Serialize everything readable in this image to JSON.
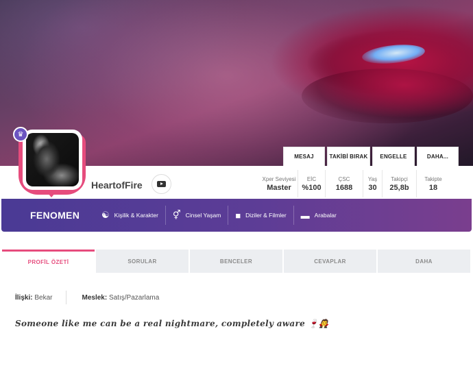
{
  "profile": {
    "username": "HeartofFire",
    "rank": "FENOMEN",
    "crown_icon": "crown-icon",
    "accent_color": "#e64c7d",
    "brand_purple": "#4a3a95"
  },
  "actions": {
    "message": "MESAJ",
    "unfollow": "TAKİBİ BIRAK",
    "block": "ENGELLE",
    "more": "DAHA..."
  },
  "stats": [
    {
      "label": "Xper Seviyesi",
      "value": "Master"
    },
    {
      "label": "EİC",
      "value": "%100"
    },
    {
      "label": "ÇSC",
      "value": "1688"
    },
    {
      "label": "Yaş",
      "value": "30"
    },
    {
      "label": "Takipçi",
      "value": "25,8b"
    },
    {
      "label": "Takipte",
      "value": "18"
    }
  ],
  "nav": {
    "items": [
      {
        "label": "Kişilik & Karakter",
        "icon": "personality-icon"
      },
      {
        "label": "Cinsel Yaşam",
        "icon": "gender-icon"
      },
      {
        "label": "Diziler & Filmler",
        "icon": "camera-icon"
      },
      {
        "label": "Arabalar",
        "icon": "car-icon"
      }
    ]
  },
  "tabs": [
    {
      "label": "PROFİL ÖZETİ"
    },
    {
      "label": "SORULAR"
    },
    {
      "label": "BENCELER"
    },
    {
      "label": "CEVAPLAR"
    },
    {
      "label": "DAHA"
    }
  ],
  "details": {
    "relationship_label": "İlişki:",
    "relationship_value": "Bekar",
    "job_label": "Meslek:",
    "job_value": "Satış/Pazarlama"
  },
  "bio": "Someone like me can be a real nightmare, completely aware 🍷🧛"
}
